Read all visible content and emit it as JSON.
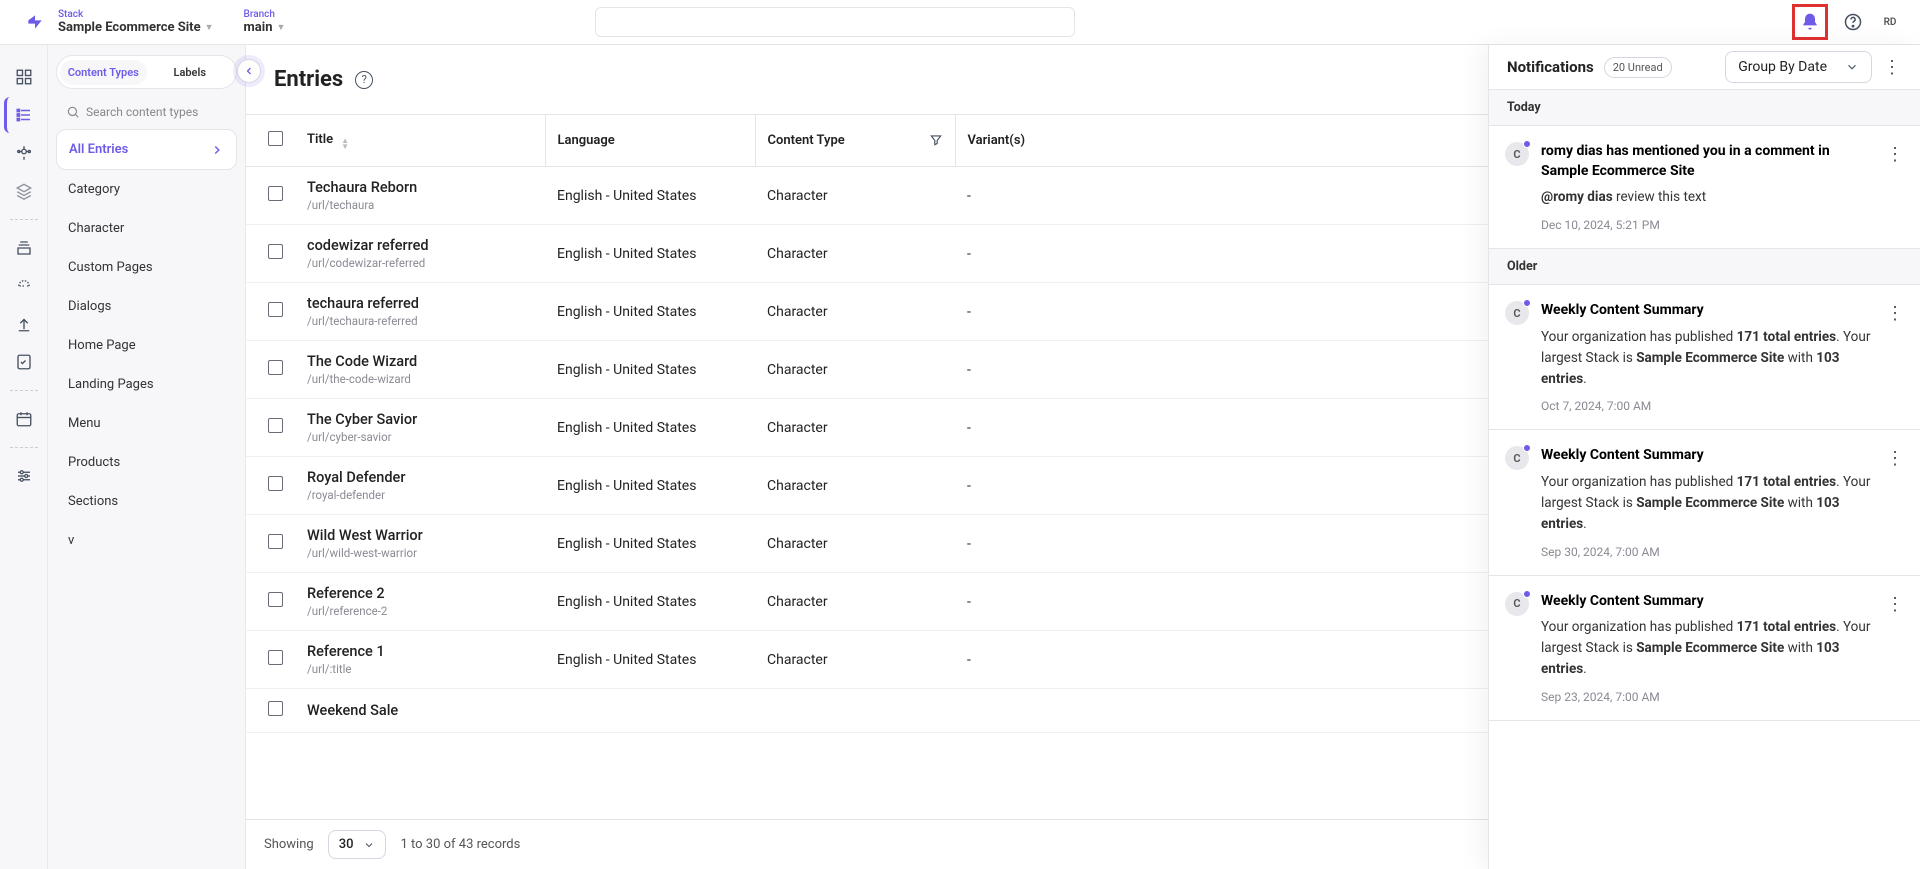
{
  "header": {
    "stack_label": "Stack",
    "stack_value": "Sample Ecommerce Site",
    "branch_label": "Branch",
    "branch_value": "main",
    "avatar_initials": "RD"
  },
  "sidebar": {
    "tabs": {
      "content_types": "Content Types",
      "labels": "Labels"
    },
    "search_placeholder": "Search content types",
    "items": [
      {
        "label": "All Entries",
        "active": true,
        "has_arrow": true
      },
      {
        "label": "Category"
      },
      {
        "label": "Character"
      },
      {
        "label": "Custom Pages"
      },
      {
        "label": "Dialogs"
      },
      {
        "label": "Home Page"
      },
      {
        "label": "Landing Pages"
      },
      {
        "label": "Menu"
      },
      {
        "label": "Products"
      },
      {
        "label": "Sections"
      },
      {
        "label": "v"
      }
    ]
  },
  "main": {
    "title": "Entries",
    "columns": {
      "title": "Title",
      "language": "Language",
      "content_type": "Content Type",
      "variants": "Variant(s)"
    },
    "rows": [
      {
        "title": "Techaura Reborn",
        "url": "/url/techaura",
        "language": "English - United States",
        "ct": "Character",
        "variants": "-"
      },
      {
        "title": "codewizar referred",
        "url": "/url/codewizar-referred",
        "language": "English - United States",
        "ct": "Character",
        "variants": "-"
      },
      {
        "title": "techaura referred",
        "url": "/url/techaura-referred",
        "language": "English - United States",
        "ct": "Character",
        "variants": "-"
      },
      {
        "title": "The Code Wizard",
        "url": "/url/the-code-wizard",
        "language": "English - United States",
        "ct": "Character",
        "variants": "-"
      },
      {
        "title": "The Cyber Savior",
        "url": "/url/cyber-savior",
        "language": "English - United States",
        "ct": "Character",
        "variants": "-"
      },
      {
        "title": "Royal Defender",
        "url": "/royal-defender",
        "language": "English - United States",
        "ct": "Character",
        "variants": "-"
      },
      {
        "title": "Wild West Warrior",
        "url": "/url/wild-west-warrior",
        "language": "English - United States",
        "ct": "Character",
        "variants": "-"
      },
      {
        "title": "Reference 2",
        "url": "/url/reference-2",
        "language": "English - United States",
        "ct": "Character",
        "variants": "-"
      },
      {
        "title": "Reference 1",
        "url": "/url/:title",
        "language": "English - United States",
        "ct": "Character",
        "variants": "-"
      },
      {
        "title": "Weekend Sale",
        "url": "",
        "language": "",
        "ct": "",
        "variants": ""
      }
    ],
    "footer": {
      "showing": "Showing",
      "page_size": "30",
      "range": "1 to 30 of 43 records"
    }
  },
  "notifications": {
    "title": "Notifications",
    "unread": "20 Unread",
    "group_by": "Group By Date",
    "sections": [
      {
        "label": "Today",
        "items": [
          {
            "avatar": "C",
            "heading": "romy dias has mentioned you in a comment in Sample Ecommerce Site",
            "text_html": "<b>@romy dias</b> review this text",
            "time": "Dec 10, 2024, 5:21 PM"
          }
        ]
      },
      {
        "label": "Older",
        "items": [
          {
            "avatar": "C",
            "heading": "Weekly Content Summary",
            "text_html": "Your organization has published <b>171 total entries</b>. Your largest Stack is <b>Sample Ecommerce Site</b> with <b>103 entries</b>.",
            "time": "Oct 7, 2024, 7:00 AM"
          },
          {
            "avatar": "C",
            "heading": "Weekly Content Summary",
            "text_html": "Your organization has published <b>171 total entries</b>. Your largest Stack is <b>Sample Ecommerce Site</b> with <b>103 entries</b>.",
            "time": "Sep 30, 2024, 7:00 AM"
          },
          {
            "avatar": "C",
            "heading": "Weekly Content Summary",
            "text_html": "Your organization has published <b>171 total entries</b>. Your largest Stack is <b>Sample Ecommerce Site</b> with <b>103 entries</b>.",
            "time": "Sep 23, 2024, 7:00 AM"
          }
        ]
      }
    ]
  }
}
